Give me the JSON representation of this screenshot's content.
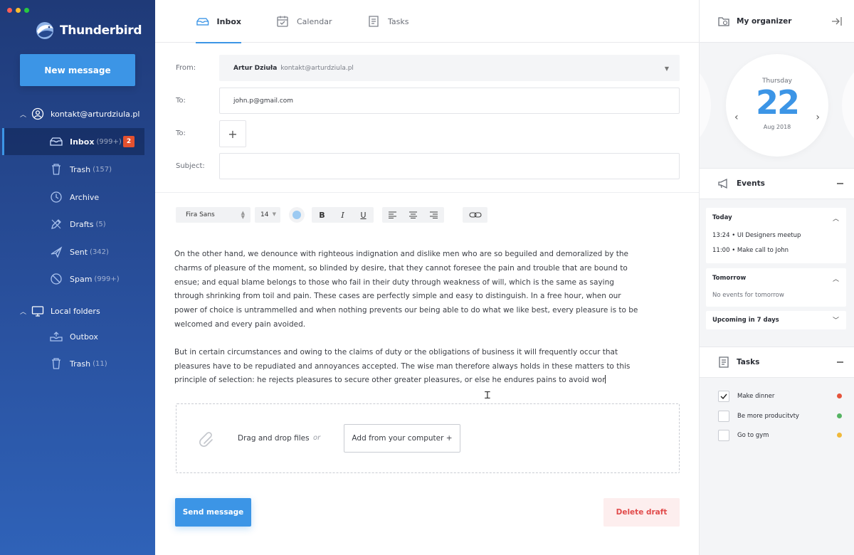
{
  "app": {
    "name": "Thunderbird"
  },
  "colors": {
    "accent": "#3c95e6",
    "danger": "#e14b4b",
    "badge": "#e4512f",
    "dot_red": "#e5543b",
    "dot_green": "#55b463",
    "dot_yellow": "#f0b93a",
    "win_close": "#ff5f56",
    "win_min": "#ffbd2e",
    "win_max": "#27c93f"
  },
  "sidebar": {
    "new_message": "New message",
    "account": "kontakt@arturdziula.pl",
    "folders": [
      {
        "name": "Inbox",
        "count": "(999+)",
        "badge": "2",
        "icon": "inbox-icon"
      },
      {
        "name": "Trash",
        "count": "(157)",
        "icon": "trash-icon"
      },
      {
        "name": "Archive",
        "count": "",
        "icon": "clock-icon"
      },
      {
        "name": "Drafts",
        "count": "(5)",
        "icon": "pencil-icon"
      },
      {
        "name": "Sent",
        "count": "(342)",
        "icon": "paper-plane-icon"
      },
      {
        "name": "Spam",
        "count": "(999+)",
        "icon": "blocked-icon"
      }
    ],
    "local": "Local folders",
    "local_folders": [
      {
        "name": "Outbox",
        "count": "",
        "icon": "outbox-icon"
      },
      {
        "name": "Trash",
        "count": "(11)",
        "icon": "trash-icon"
      }
    ]
  },
  "tabs": [
    {
      "label": "Inbox",
      "icon": "inbox-icon"
    },
    {
      "label": "Calendar",
      "icon": "calendar-icon"
    },
    {
      "label": "Tasks",
      "icon": "tasks-icon"
    }
  ],
  "compose": {
    "from_label": "From:",
    "from_name": "Artur Dziuła",
    "from_email": "kontakt@arturdziula.pl",
    "to_label": "To:",
    "to_value": "john.p@gmail.com",
    "to2_label": "To:",
    "subject_label": "Subject:",
    "subject_value": "",
    "font": "Fira Sans",
    "size": "14",
    "body_p1": "On the other hand, we denounce with righteous indignation and dislike men who are so beguiled and demoralized by the charms of pleasure of the moment, so blinded by desire, that they cannot foresee the pain and trouble that are bound to ensue; and equal blame belongs to those who fail in their duty through weakness of will, which is the same as saying through shrinking from toil and pain. These cases are perfectly simple and easy to distinguish. In a free hour, when our power of choice is untrammelled and when nothing prevents our being able to do what we like best, every pleasure is to be welcomed and every pain avoided.",
    "body_p2": "But in certain circumstances and owing to the claims of duty or the obligations of business it will frequently occur that pleasures have to be repudiated and annoyances accepted. The wise man therefore always holds in these matters to this principle of selection: he rejects pleasures to secure other greater pleasures, or else he endures pains to avoid wor",
    "drop_text": "Drag and drop files",
    "drop_or": "or",
    "drop_button": "Add from your computer  +",
    "send": "Send message",
    "delete": "Delete draft"
  },
  "organizer": {
    "title": "My organizer",
    "day": "Thursday",
    "date": "22",
    "month": "Aug 2018",
    "events_title": "Events",
    "today_label": "Today",
    "today_events": [
      {
        "time": "13:24",
        "name": "UI Designers meetup"
      },
      {
        "time": "11:00",
        "name": "Make call to John"
      }
    ],
    "tomorrow_label": "Tomorrow",
    "tomorrow_empty": "No events for tomorrow",
    "upcoming_label": "Upcoming in 7 days",
    "tasks_title": "Tasks",
    "tasks": [
      {
        "name": "Make dinner",
        "done": true,
        "priority": "red"
      },
      {
        "name": "Be more producitvty",
        "done": false,
        "priority": "green"
      },
      {
        "name": "Go to gym",
        "done": false,
        "priority": "yellow"
      }
    ]
  }
}
